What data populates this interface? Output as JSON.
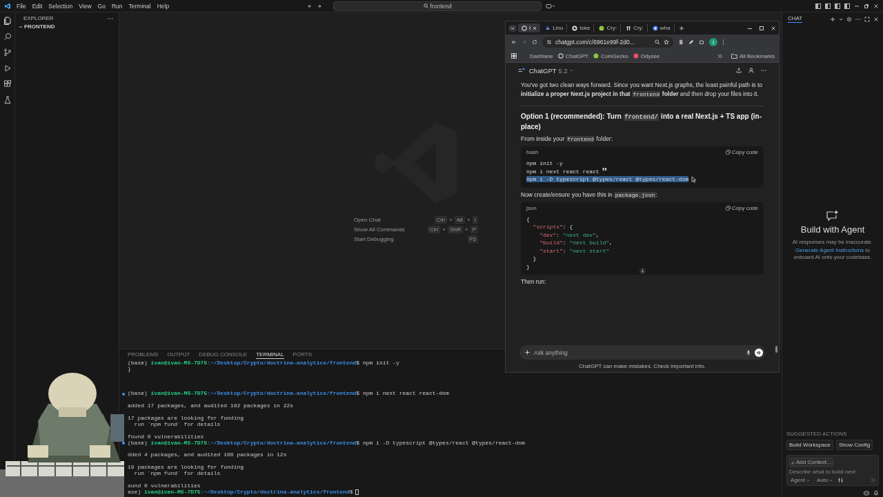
{
  "titlebar": {
    "menu": [
      "File",
      "Edit",
      "Selection",
      "View",
      "Go",
      "Run",
      "Terminal",
      "Help"
    ],
    "search": "frontend"
  },
  "explorer": {
    "title": "EXPLORER",
    "folder": {
      "label": "FRONTEND",
      "expanded": true
    }
  },
  "welcome": {
    "separator": "+",
    "shortcuts": [
      {
        "label": "Open Chat",
        "keys": [
          "Ctrl",
          "Alt",
          "I"
        ]
      },
      {
        "label": "Show All Commands",
        "keys": [
          "Ctrl",
          "Shift",
          "P"
        ]
      },
      {
        "label": "Start Debugging",
        "keys": [
          "F5"
        ]
      }
    ]
  },
  "panel": {
    "tabs": [
      {
        "label": "PROBLEMS",
        "selected": false
      },
      {
        "label": "OUTPUT",
        "selected": false
      },
      {
        "label": "DEBUG CONSOLE",
        "selected": false
      },
      {
        "label": "TERMINAL",
        "selected": true
      },
      {
        "label": "PORTS",
        "selected": false
      }
    ],
    "terminal": [
      {
        "kind": "prompt",
        "decorated": false,
        "cursor": false,
        "env": "(base) ",
        "user": "ivan@ivan-MS-7D75",
        "path": ":~/Desktop/Crypto/doctrina-analytics/frontend",
        "command": "$ npm init -y"
      },
      {
        "kind": "output",
        "text": "}"
      },
      {
        "kind": "blank"
      },
      {
        "kind": "blank"
      },
      {
        "kind": "blank"
      },
      {
        "kind": "prompt",
        "decorated": true,
        "cursor": false,
        "env": "(base) ",
        "user": "ivan@ivan-MS-7D75",
        "path": ":~/Desktop/Crypto/doctrina-analytics/frontend",
        "command": "$ npm i next react react-dom"
      },
      {
        "kind": "blank"
      },
      {
        "kind": "output",
        "text": "added 17 packages, and audited 102 packages in 22s"
      },
      {
        "kind": "blank"
      },
      {
        "kind": "output",
        "text": "17 packages are looking for funding"
      },
      {
        "kind": "output",
        "text": "  run `npm fund` for details"
      },
      {
        "kind": "blank"
      },
      {
        "kind": "output",
        "text": "found 0 vulnerabilities"
      },
      {
        "kind": "prompt",
        "decorated": true,
        "cursor": false,
        "env": "(base) ",
        "user": "ivan@ivan-MS-7D75",
        "path": ":~/Desktop/Crypto/doctrina-analytics/frontend",
        "command": "$ npm i -D typescript @types/react @types/react-dom"
      },
      {
        "kind": "blank"
      },
      {
        "kind": "output",
        "text": "dded 4 packages, and audited 106 packages in 12s"
      },
      {
        "kind": "blank"
      },
      {
        "kind": "output",
        "text": "19 packages are looking for funding"
      },
      {
        "kind": "output",
        "text": "  run `npm fund` for details"
      },
      {
        "kind": "blank"
      },
      {
        "kind": "output",
        "text": "ound 0 vulnerabilities"
      },
      {
        "kind": "prompt",
        "decorated": false,
        "cursor": true,
        "env": "ase) ",
        "user": "ivan@ivan-MS-7D75",
        "path": ":~/Desktop/Crypto/doctrina-analytics/frontend",
        "command": "$"
      }
    ]
  },
  "browser": {
    "tabs": [
      {
        "label": "I",
        "selected": true
      },
      {
        "label": "Linu",
        "selected": false
      },
      {
        "label": "toke",
        "selected": false
      },
      {
        "label": "Cry:",
        "selected": false
      },
      {
        "label": "Cry:",
        "selected": false
      },
      {
        "label": "wha",
        "selected": false
      }
    ],
    "address": "chatgpt.com/c/6961e99f-2d0...",
    "profile": "I",
    "bookmarks": [
      "Dashlane",
      "ChatGPT",
      "CoinGecko",
      "Odysee"
    ],
    "all_bookmarks": "All Bookmarks",
    "model": "ChatGPT",
    "version": "5.2",
    "blocks": [
      {
        "kind": "paragraph",
        "parts": [
          {
            "kind": "plain",
            "text": "You've got two clean ways forward. Since you want Next.js graphs, the least painful path is to "
          },
          {
            "kind": "bold",
            "text": "initialize a proper Next.js project in that "
          },
          {
            "kind": "code",
            "text": "frontend"
          },
          {
            "kind": "bold",
            "text": " folder"
          },
          {
            "kind": "plain",
            "text": " and then drop your files into it."
          }
        ]
      },
      {
        "kind": "divider"
      },
      {
        "kind": "heading",
        "parts": [
          {
            "kind": "plain",
            "text": "Option 1 (recommended): Turn "
          },
          {
            "kind": "code",
            "text": "frontend/"
          },
          {
            "kind": "plain",
            "text": " into a real Next.js + TS app (in-place)"
          }
        ]
      },
      {
        "kind": "paragraph",
        "parts": [
          {
            "kind": "plain",
            "text": "From inside your "
          },
          {
            "kind": "code",
            "text": "frontend"
          },
          {
            "kind": "plain",
            "text": " folder:"
          }
        ]
      },
      {
        "kind": "code",
        "lang": "bash",
        "copy": "Copy code",
        "lines": [
          [
            {
              "kind": "plain",
              "text": "npm init -y"
            }
          ],
          [
            {
              "kind": "plain",
              "text": "npm i next react react"
            }
          ],
          [
            {
              "kind": "selected",
              "text": "npm i -D typescript @types/react @types/react-dom"
            }
          ]
        ]
      },
      {
        "kind": "paragraph",
        "parts": [
          {
            "kind": "plain",
            "text": "Now create/ensure you have this in "
          },
          {
            "kind": "code",
            "text": "package.json"
          },
          {
            "kind": "plain",
            "text": ":"
          }
        ]
      },
      {
        "kind": "code",
        "lang": "json",
        "copy": "Copy code",
        "lines": [
          [
            {
              "kind": "plain",
              "text": "{"
            }
          ],
          [
            {
              "kind": "key",
              "text": "  \"scripts\""
            },
            {
              "kind": "plain",
              "text": ": {"
            }
          ],
          [
            {
              "kind": "key",
              "text": "    \"dev\""
            },
            {
              "kind": "plain",
              "text": ": "
            },
            {
              "kind": "str",
              "text": "\"next dev\""
            },
            {
              "kind": "plain",
              "text": ","
            }
          ],
          [
            {
              "kind": "key",
              "text": "    \"build\""
            },
            {
              "kind": "plain",
              "text": ": "
            },
            {
              "kind": "str",
              "text": "\"next build\""
            },
            {
              "kind": "plain",
              "text": ","
            }
          ],
          [
            {
              "kind": "key",
              "text": "    \"start\""
            },
            {
              "kind": "plain",
              "text": ": "
            },
            {
              "kind": "str",
              "text": "\"next start\""
            }
          ],
          [
            {
              "kind": "plain",
              "text": "  }"
            }
          ],
          [
            {
              "kind": "plain",
              "text": "}"
            }
          ]
        ]
      },
      {
        "kind": "paragraph",
        "parts": [
          {
            "kind": "plain",
            "text": "Then run:"
          }
        ]
      }
    ],
    "input_placeholder": "Ask anything",
    "disclaimer": "ChatGPT can make mistakes. Check important info."
  },
  "chat": {
    "tab": "CHAT",
    "title": "Build with Agent",
    "note": "AI responses may be inaccurate.",
    "link": "Generate Agent Instructions",
    "link_rest": " to onboard AI onto your codebase.",
    "suggested_title": "SUGGESTED ACTIONS",
    "actions": [
      "Build Workspace",
      "Show Config"
    ],
    "context": "Add Context...",
    "placeholder": "Describe what to build next",
    "mode": "Agent",
    "model": "Auto"
  }
}
